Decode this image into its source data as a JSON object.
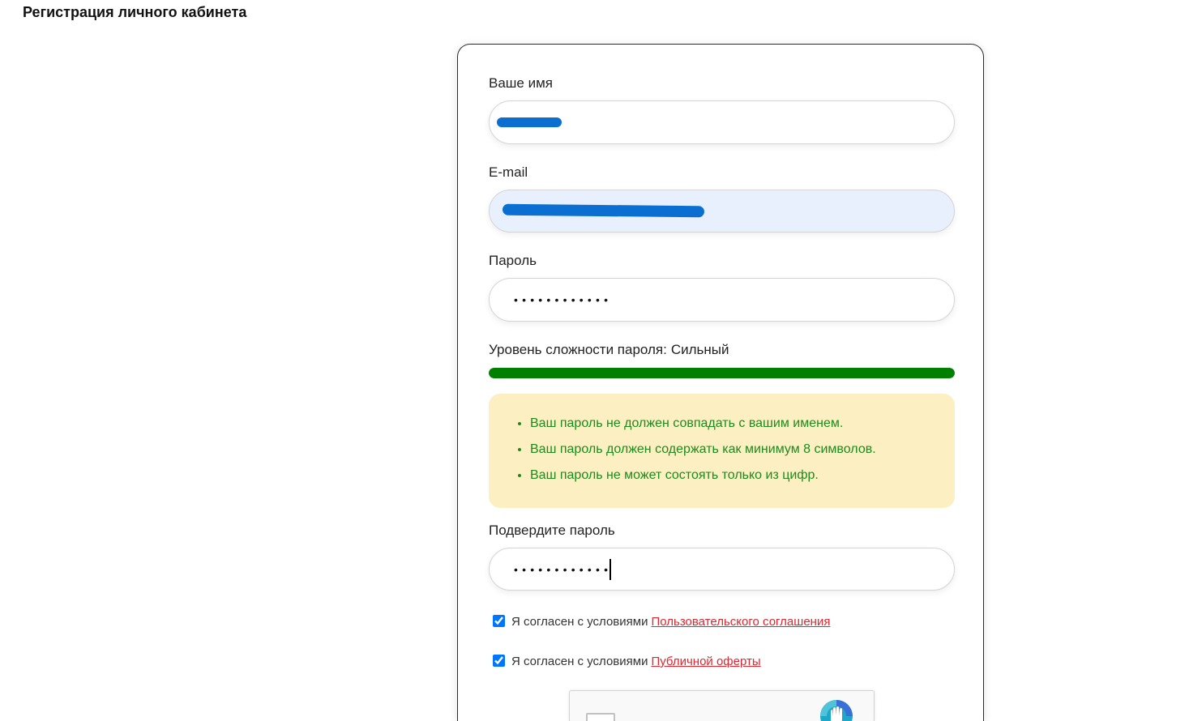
{
  "page": {
    "title": "Регистрация личного кабинета"
  },
  "form": {
    "name": {
      "label": "Ваше имя",
      "value": ""
    },
    "email": {
      "label": "E-mail",
      "value": ""
    },
    "password": {
      "label": "Пароль",
      "value": "••••••••••••"
    },
    "strength": {
      "label": "Уровень сложности пароля:",
      "value": "Сильный",
      "level": 1.0
    },
    "hints": [
      "Ваш пароль не должен совпадать с вашим именем.",
      "Ваш пароль должен содержать как минимум 8 символов.",
      "Ваш пароль не может состоять только из цифр."
    ],
    "confirm": {
      "label": "Подвердите пароль",
      "value": "••••••••••••"
    },
    "agreements": [
      {
        "checked": true,
        "text": "Я согласен с условиями",
        "link": "Пользовательского соглашения"
      },
      {
        "checked": true,
        "text": "Я согласен с условиями",
        "link": "Публичной оферты"
      }
    ]
  },
  "colors": {
    "strength_fill": "#008000",
    "hint_text": "#1f8a1f",
    "hint_background": "#fcefc1",
    "link": "#e0262f",
    "autofill_background": "#e8f0fe",
    "redaction": "#0b6fd1"
  },
  "icons": {
    "recaptcha": "recaptcha-logo-icon"
  }
}
